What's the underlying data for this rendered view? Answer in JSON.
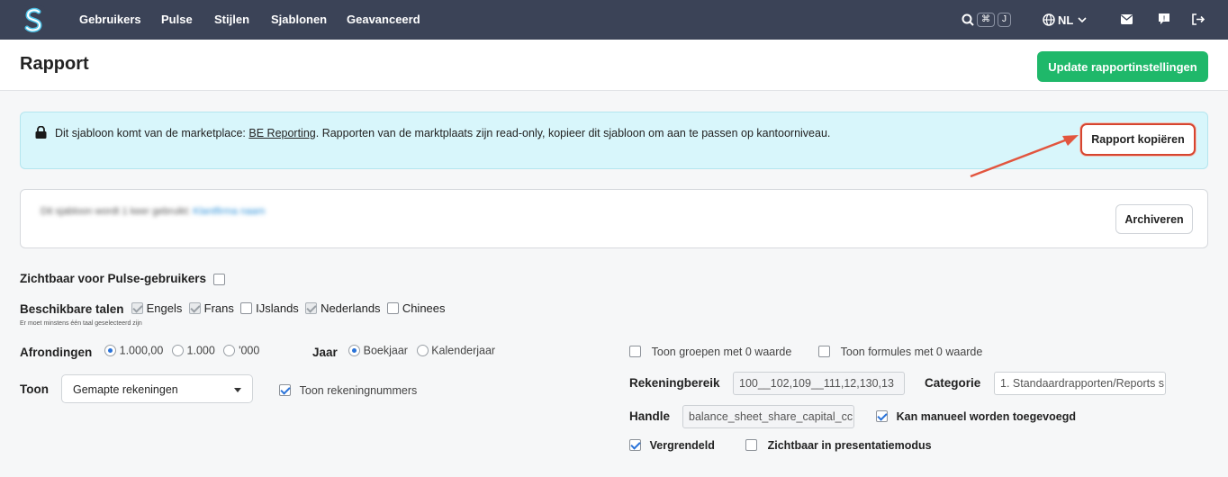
{
  "nav": {
    "logo_letter": "S",
    "items": [
      "Gebruikers",
      "Pulse",
      "Stijlen",
      "Sjablonen",
      "Geavanceerd"
    ],
    "search_kbd": [
      "⌘",
      "J"
    ],
    "language": "NL"
  },
  "header": {
    "title": "Rapport",
    "update_button": "Update rapportinstellingen"
  },
  "alert": {
    "text_before": "Dit sjabloon komt van de marketplace: ",
    "link": "BE Reporting",
    "text_after": ". Rapporten van de marktplaats zijn read-only, kopieer dit sjabloon om aan te passen op kantoorniveau.",
    "copy_button": "Rapport kopiëren"
  },
  "info": {
    "blurred_text": "Dit sjabloon wordt 1 keer gebruikt:",
    "blurred_link": "Klantfirma naam",
    "archive_button": "Archiveren"
  },
  "form": {
    "visible_label": "Zichtbaar voor Pulse-gebruikers",
    "languages_label": "Beschikbare talen",
    "languages_hint": "Er moet minstens één taal geselecteerd zijn",
    "languages": [
      "Engels",
      "Frans",
      "IJslands",
      "Nederlands",
      "Chinees"
    ],
    "rounding_label": "Afrondingen",
    "rounding_options": [
      "1.000,00",
      "1.000",
      "'000"
    ],
    "year_label": "Jaar",
    "year_options": [
      "Boekjaar",
      "Kalenderjaar"
    ],
    "show_label": "Toon",
    "show_value": "Gemapte rekeningen",
    "show_account_numbers": "Toon rekeningnummers",
    "show_zero_groups": "Toon groepen met 0 waarde",
    "show_zero_formulas": "Toon formules met 0 waarde",
    "account_range_label": "Rekeningbereik",
    "account_range_value": "100__102,109__111,12,130,13",
    "category_label": "Categorie",
    "category_value": "1. Standaardrapporten/Reports s",
    "handle_label": "Handle",
    "handle_value": "balance_sheet_share_capital_cc",
    "manual_add": "Kan manueel worden toegevoegd",
    "locked": "Vergrendeld",
    "presentation_visible": "Zichtbaar in presentatiemodus"
  }
}
